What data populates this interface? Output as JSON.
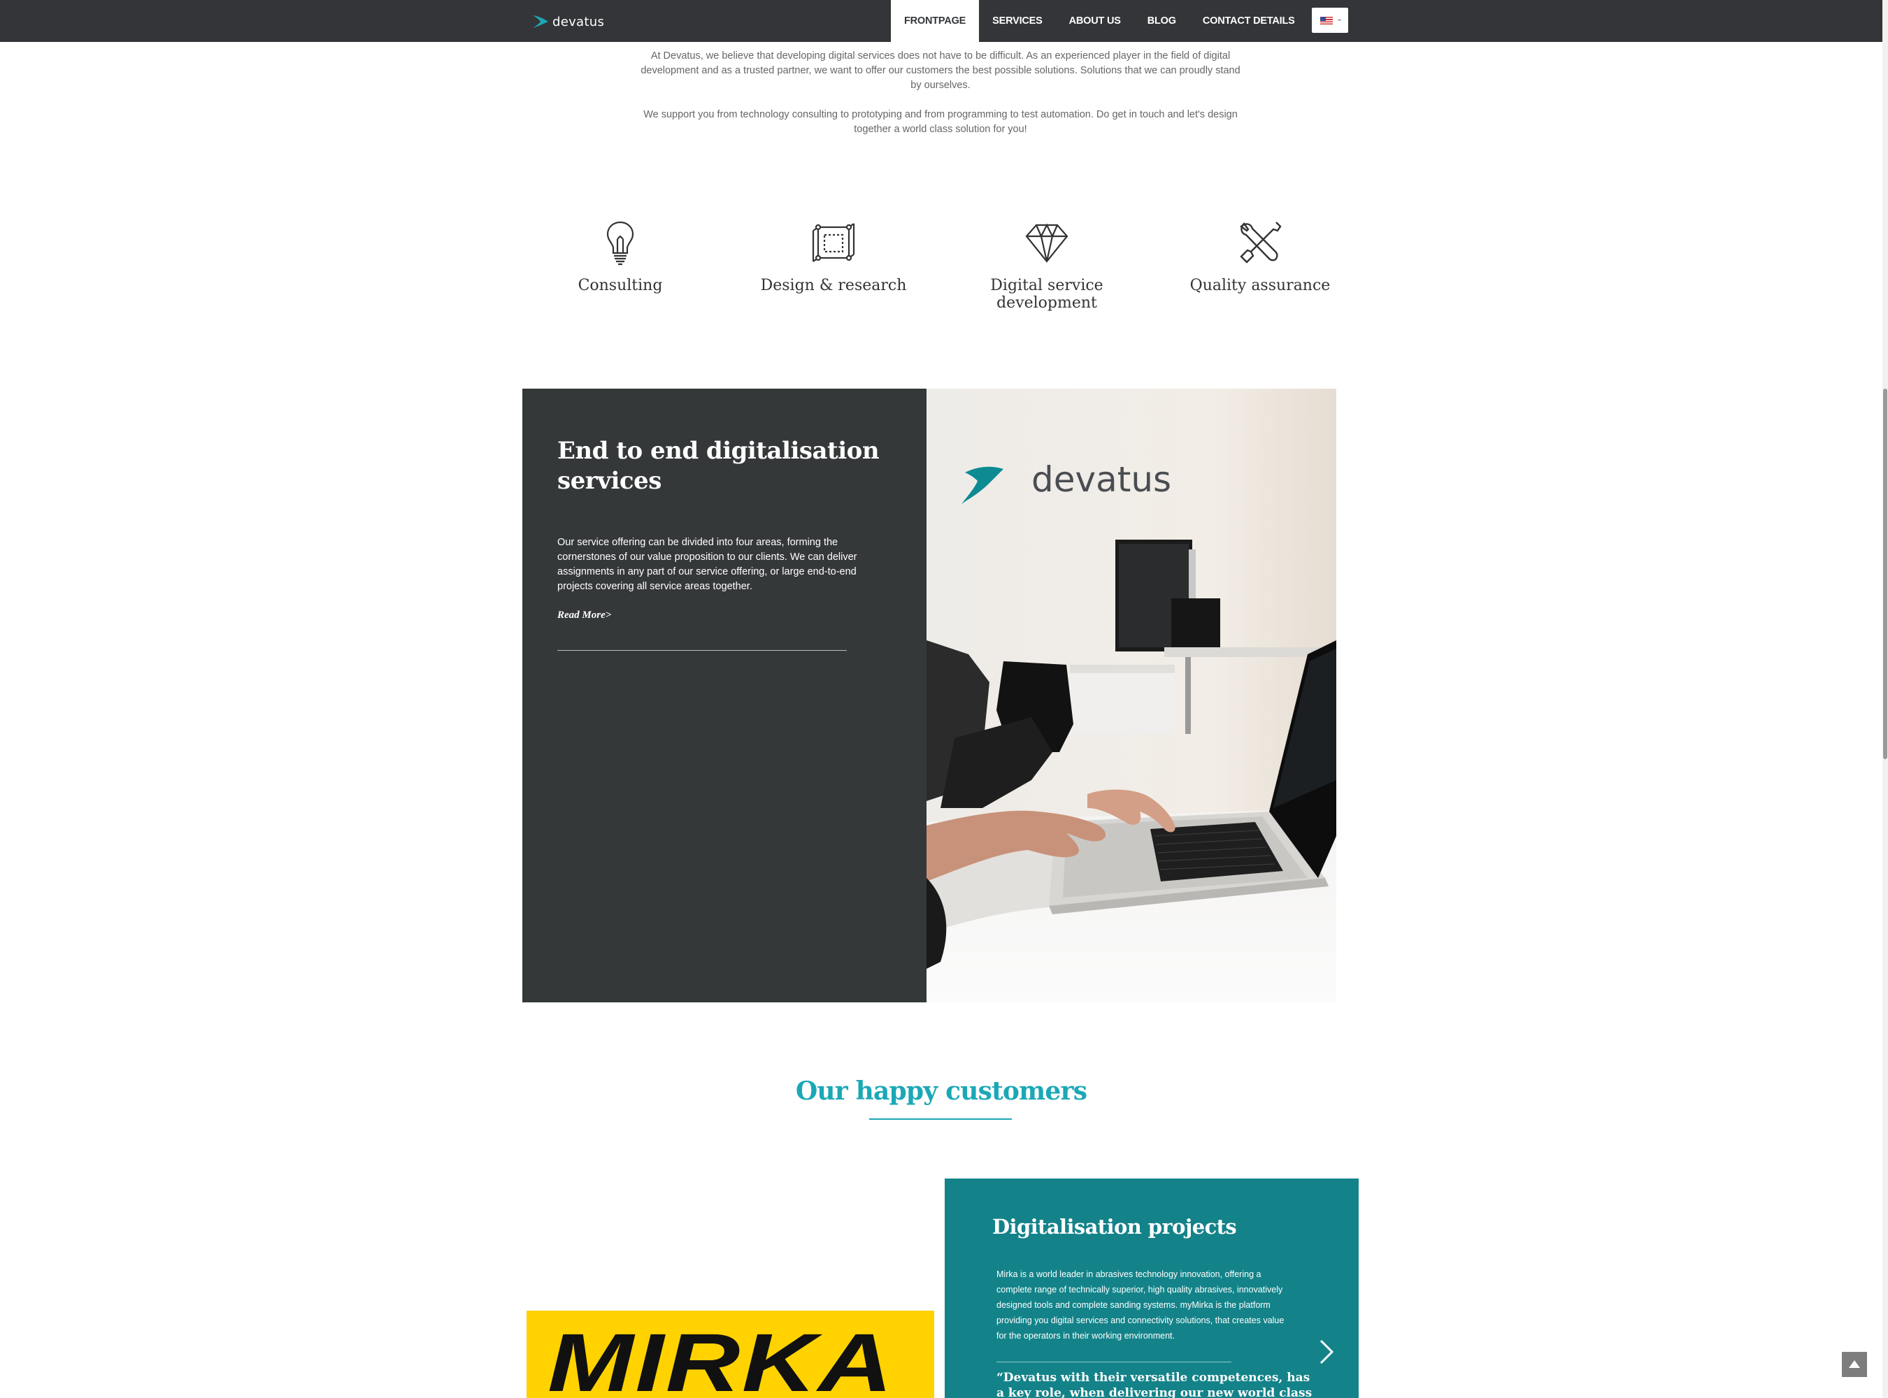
{
  "header": {
    "logo_text": "devatus",
    "nav": [
      {
        "label": "FRONTPAGE",
        "active": true
      },
      {
        "label": "SERVICES",
        "active": false
      },
      {
        "label": "ABOUT US",
        "active": false
      },
      {
        "label": "BLOG",
        "active": false
      },
      {
        "label": "CONTACT DETAILS",
        "active": false
      }
    ],
    "language_icon": "us-flag-icon"
  },
  "intro": {
    "p1": "At Devatus, we believe that developing digital services does not have to be difficult. As an experienced player in the field of digital development and as a trusted partner, we want to offer our customers the best possible solutions. Solutions that we can proudly stand by ourselves.",
    "p2": "We support you from technology consulting to prototyping and from programming to test automation. Do get in touch and let's design together a world class solution for you!"
  },
  "services": [
    {
      "label": "Consulting",
      "icon": "lightbulb-icon"
    },
    {
      "label": "Design & research",
      "icon": "cube-icon"
    },
    {
      "label": "Digital service development",
      "icon": "diamond-icon"
    },
    {
      "label": "Quality assurance",
      "icon": "tools-icon"
    }
  ],
  "feature": {
    "title": "End to end digitalisation services",
    "text": "Our service offering can be divided into four areas, forming the cornerstones of our value proposition to our clients. We can deliver assignments in any part of our service offering, or large end-to-end projects covering all service areas together.",
    "read_more": "Read More>",
    "photo_logo_text": "devatus"
  },
  "customers": {
    "title": "Our happy customers",
    "logo_text": "MIRKA",
    "card": {
      "title": "Digitalisation projects",
      "text": "Mirka is a world leader in abrasives technology innovation, offering a complete range of technically superior, high quality abrasives, innovatively designed tools and complete sanding systems. myMirka is the platform providing you digital services and connectivity solutions, that creates value for the operators in their working environment.",
      "quote": "“Devatus with their versatile competences, has a key role, when delivering our new world class digitalisation"
    }
  },
  "colors": {
    "nav_bg": "#333538",
    "accent": "#1ba8b6",
    "card_bg": "#138389",
    "feature_bg": "#353839",
    "mirka_yellow": "#ffd200"
  }
}
